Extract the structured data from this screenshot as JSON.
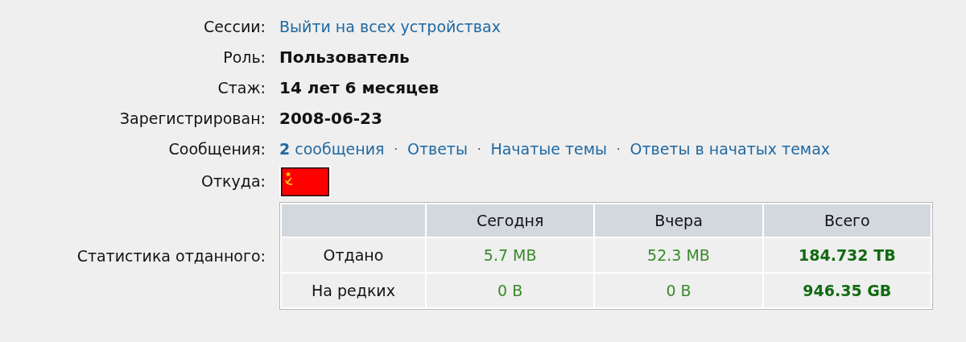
{
  "fields": [
    {
      "kind": "link",
      "label": "Сессии:",
      "value": "Выйти на всех устройствах"
    },
    {
      "kind": "bold",
      "label": "Роль:",
      "value": "Пользователь"
    },
    {
      "kind": "bold",
      "label": "Стаж:",
      "value": "14 лет 6 месяцев"
    },
    {
      "kind": "bold",
      "label": "Зарегистрирован:",
      "value": "2008-06-23"
    },
    {
      "kind": "links",
      "label": "Сообщения:",
      "separator": "·",
      "links": [
        "**2** сообщения",
        "Ответы",
        "Начатые темы",
        "Ответы в начатых темах"
      ]
    },
    {
      "kind": "flag",
      "label": "Откуда:"
    },
    {
      "kind": "table",
      "label": "Статистика отданного:",
      "table": {
        "columns": [
          "Сегодня",
          "Вчера",
          "Всего"
        ],
        "rows": [
          {
            "label": "Отдано",
            "cells": [
              {
                "value": "5.7 MB",
                "bold": false
              },
              {
                "value": "52.3 MB",
                "bold": false
              },
              {
                "value": "184.732 TB",
                "bold": true
              }
            ]
          },
          {
            "label": "На редких",
            "cells": [
              {
                "value": "0 B",
                "bold": false
              },
              {
                "value": "0 B",
                "bold": false
              },
              {
                "value": "946.35 GB",
                "bold": true
              }
            ]
          }
        ]
      }
    }
  ]
}
